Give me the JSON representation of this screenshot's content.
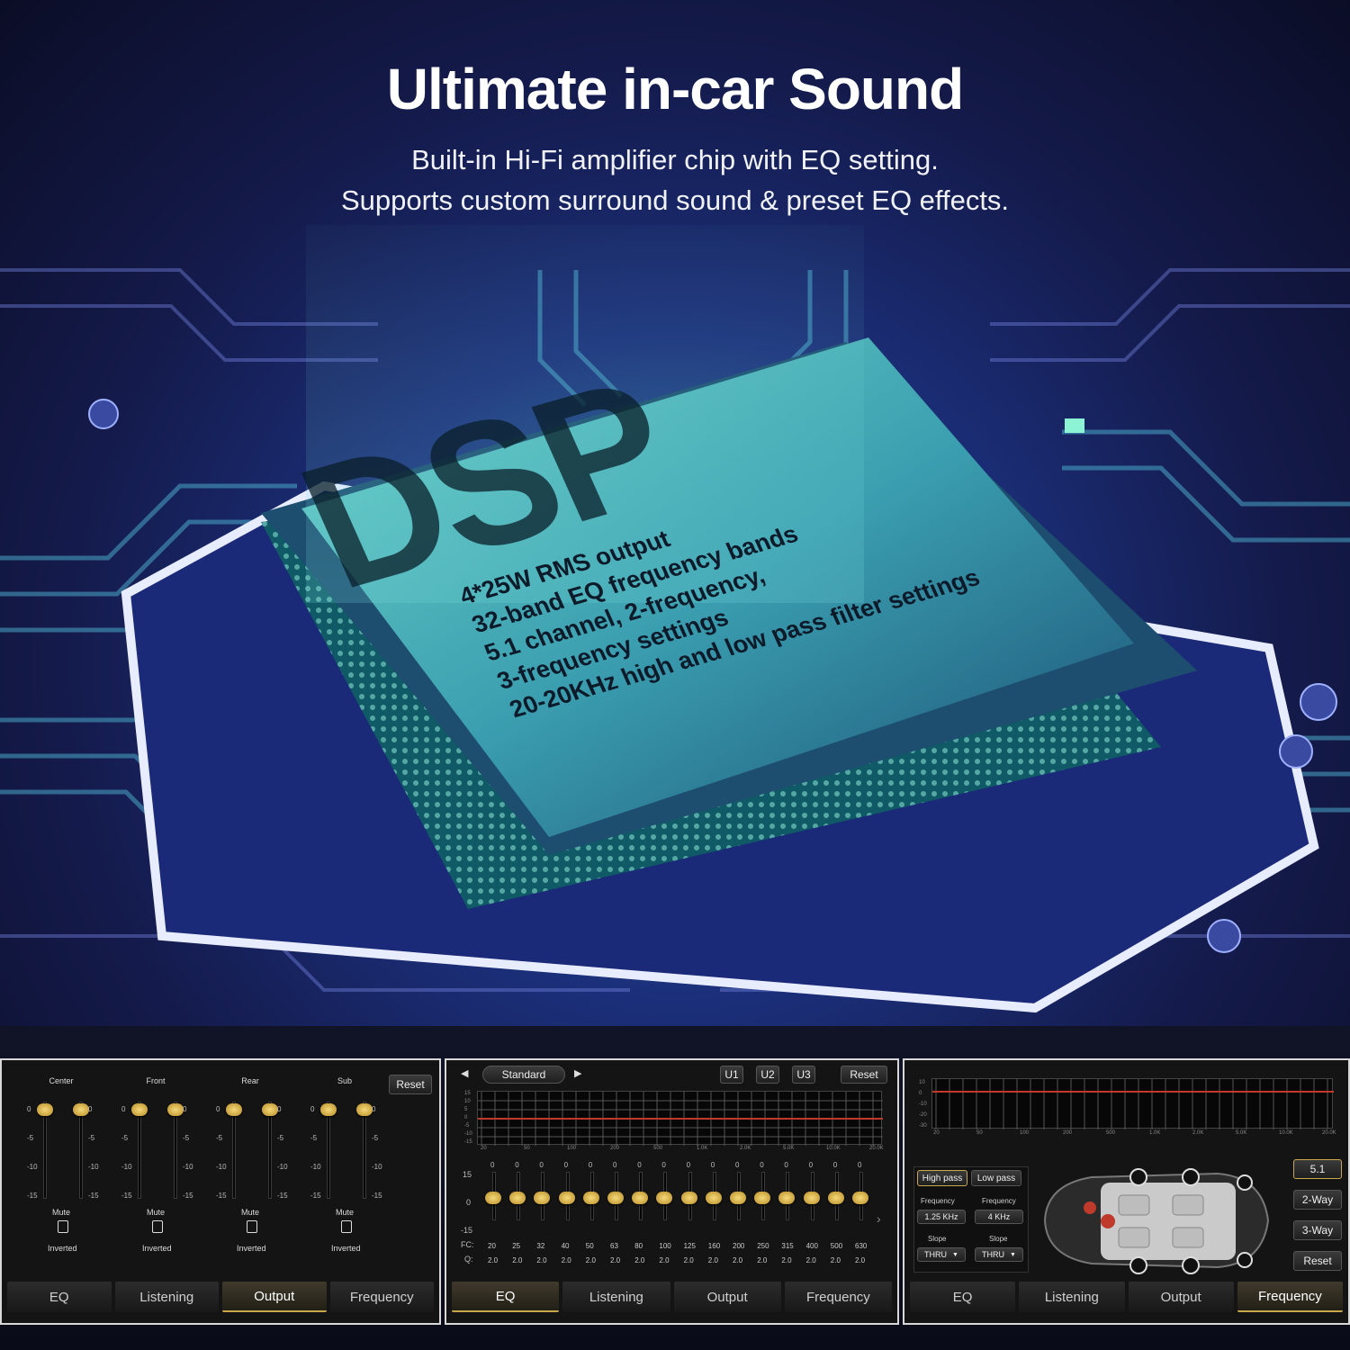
{
  "hero": {
    "headline": "Ultimate in-car Sound",
    "sub1": "Built-in Hi-Fi amplifier chip with EQ setting.",
    "sub2": "Supports custom surround sound & preset EQ effects.",
    "chip_logo": "DSP",
    "specs": [
      "4*25W RMS output",
      "32-band EQ frequency bands",
      "5.1 channel, 2-frequency,",
      "3-frequency settings",
      "20-20KHz high and low pass filter settings"
    ]
  },
  "colors": {
    "accent_gold": "#c9a74a",
    "panel_bg": "#141414",
    "grid_red": "#c03a2b"
  },
  "tabs": [
    "EQ",
    "Listening",
    "Output",
    "Frequency"
  ],
  "panel_output": {
    "reset_label": "Reset",
    "groups": [
      "Center",
      "Front",
      "Rear",
      "Sub"
    ],
    "scale": [
      "0",
      "-5",
      "-10",
      "-15"
    ],
    "mute_label": "Mute",
    "inverted_label": "Inverted",
    "active_tab": "Output"
  },
  "panel_eq": {
    "preset": "Standard",
    "user_presets": [
      "U1",
      "U2",
      "U3"
    ],
    "reset_label": "Reset",
    "left_scale": [
      "15",
      "0",
      "-15"
    ],
    "fc_label": "FC:",
    "q_label": "Q:",
    "frequencies": [
      "20",
      "25",
      "32",
      "40",
      "50",
      "63",
      "80",
      "100",
      "125",
      "160",
      "200",
      "250",
      "315",
      "400",
      "500",
      "630"
    ],
    "q_values": [
      "2.0",
      "2.0",
      "2.0",
      "2.0",
      "2.0",
      "2.0",
      "2.0",
      "2.0",
      "2.0",
      "2.0",
      "2.0",
      "2.0",
      "2.0",
      "2.0",
      "2.0",
      "2.0"
    ],
    "band_value": "0",
    "graph_x_labels": [
      "20",
      "50",
      "100",
      "200",
      "500",
      "1.0K",
      "2.0K",
      "5.0K",
      "10.0K",
      "20.0K"
    ],
    "graph_y_labels": [
      "15",
      "10",
      "5",
      "0",
      "-5",
      "-10",
      "-15"
    ],
    "active_tab": "EQ"
  },
  "panel_freq": {
    "high_pass": "High pass",
    "low_pass": "Low pass",
    "frequency_label": "Frequency",
    "hp_freq": "1.25 KHz",
    "lp_freq": "4 KHz",
    "slope_label": "Slope",
    "hp_slope": "THRU",
    "lp_slope": "THRU",
    "modes": [
      "5.1",
      "2-Way",
      "3-Way"
    ],
    "reset_label": "Reset",
    "graph_y_labels": [
      "10",
      "0",
      "-10",
      "-20",
      "-30"
    ],
    "graph_x_labels": [
      "20",
      "50",
      "100",
      "200",
      "500",
      "1.0K",
      "2.0K",
      "5.0K",
      "10.0K",
      "20.0K"
    ],
    "active_tab": "Frequency"
  }
}
